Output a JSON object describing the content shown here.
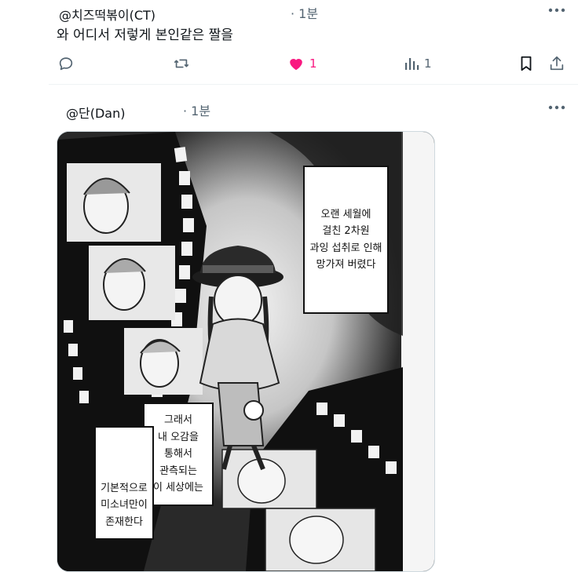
{
  "tweet1": {
    "handle": "@치즈떡볶이(CT)",
    "time": "· 1분",
    "text": "와 어디서 저렇게 본인같은 짤을",
    "like_count": "1",
    "view_count": "1"
  },
  "tweet2": {
    "handle": "@단(Dan)",
    "time": "· 1분",
    "media": {
      "caption_right": "오랜 세월에\n걸친 2차원\n과잉 섭취로 인해\n망가져 버렸다",
      "caption_left_top": "그래서\n내 오감을\n통해서\n관측되는\n이 세상에는",
      "caption_left_bottom": "기본적으로\n미소녀만이\n존재한다"
    }
  },
  "colors": {
    "like": "#f91880",
    "muted": "#536471",
    "text": "#0f1419"
  }
}
